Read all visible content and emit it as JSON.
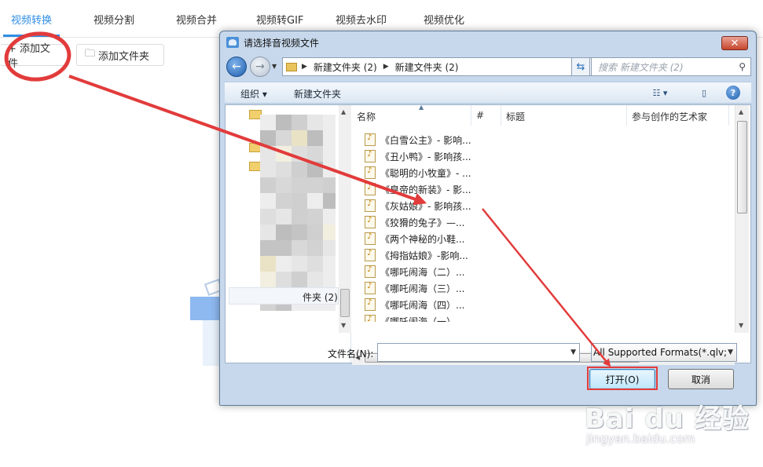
{
  "app": {
    "tabs": [
      {
        "label": "视频转换",
        "active": true
      },
      {
        "label": "视频分割"
      },
      {
        "label": "视频合并"
      },
      {
        "label": "视频转GIF"
      },
      {
        "label": "视频去水印"
      },
      {
        "label": "视频优化"
      }
    ],
    "add_file_label": "+ 添加文件",
    "add_folder_label": "添加文件夹"
  },
  "dialog": {
    "title": "请选择音视频文件",
    "close_symbol": "✕",
    "breadcrumb": [
      "新建文件夹 (2)",
      "新建文件夹 (2)"
    ],
    "search_placeholder": "搜索 新建文件夹 (2)",
    "toolbar": {
      "organize_label": "组织 ▾",
      "new_folder_label": "新建文件夹"
    },
    "nav_item_label": "件夹 (2)",
    "columns": [
      "名称",
      "#",
      "标题",
      "参与创作的艺术家"
    ],
    "files": [
      "《白雪公主》- 影响...",
      "《丑小鸭》- 影响孩...",
      "《聪明的小牧童》- ...",
      "《皇帝的新装》- 影...",
      "《灰姑娘》- 影响孩...",
      "《狡猾的兔子》—...",
      "《两个神秘的小鞋...",
      "《拇指姑娘》-影响...",
      "《哪吒闹海（二）...",
      "《哪吒闹海（三）...",
      "《哪吒闹海（四）...",
      "《哪吒闹海（一）..."
    ],
    "filename_label": "文件名(N):",
    "filename_value": "",
    "format_value": "All Supported Formats(*.qlv;",
    "open_label": "打开(O)",
    "cancel_label": "取消"
  },
  "watermark": {
    "line1": "Bai du 经验",
    "line2": "jingyan.baidu.com"
  },
  "colors": {
    "accent": "#2f8ee6",
    "annotation_red": "#e23b3b"
  }
}
